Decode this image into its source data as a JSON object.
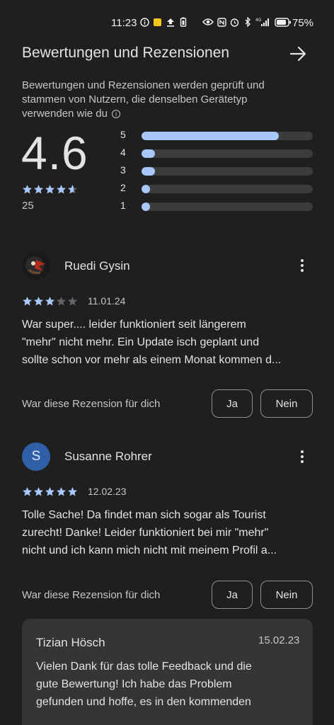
{
  "status": {
    "time": "11:23",
    "battery": "75%"
  },
  "header": {
    "title": "Bewertungen und Rezensionen"
  },
  "info": {
    "line1": "Bewertungen und Rezensionen werden geprüft und",
    "line2": "stammen von Nutzern, die denselben Gerätetyp",
    "line3": "verwenden wie du"
  },
  "summary": {
    "rating": "4.6",
    "rating_value": 4.6,
    "count": "25",
    "distribution": [
      {
        "label": "5",
        "fraction": 0.8
      },
      {
        "label": "4",
        "fraction": 0.08
      },
      {
        "label": "3",
        "fraction": 0.08
      },
      {
        "label": "2",
        "fraction": 0.05
      },
      {
        "label": "1",
        "fraction": 0.05
      }
    ]
  },
  "reviews": [
    {
      "name": "Ruedi Gysin",
      "stars": 3,
      "date": "11.01.24",
      "line1": "War super.... leider funktioniert seit längerem",
      "line2": "\"mehr\" nicht mehr. Ein Update isch geplant und",
      "line3": "sollte schon vor mehr als einem Monat kommen d...",
      "helpful": "War diese Rezension für dich",
      "yes": "Ja",
      "no": "Nein"
    },
    {
      "name": "Susanne Rohrer",
      "initial": "S",
      "stars": 5,
      "date": "12.02.23",
      "line1": "Tolle Sache! Da findet man sich sogar als Tourist",
      "line2": "zurecht! Danke! Leider funktioniert bei mir \"mehr\"",
      "line3": "nicht und ich kann mich nicht mit meinem Profil a...",
      "helpful": "War diese Rezension für dich",
      "yes": "Ja",
      "no": "Nein"
    }
  ],
  "reply": {
    "name": "Tizian Hösch",
    "date": "15.02.23",
    "line1": "Vielen Dank für das tolle Feedback und die",
    "line2": "gute Bewertung! Ich habe das Problem",
    "line3": "gefunden und hoffe, es in den kommenden"
  },
  "colors": {
    "accent": "#a8c7fa",
    "background": "#1f1f1f",
    "empty_star": "#5f6368"
  }
}
